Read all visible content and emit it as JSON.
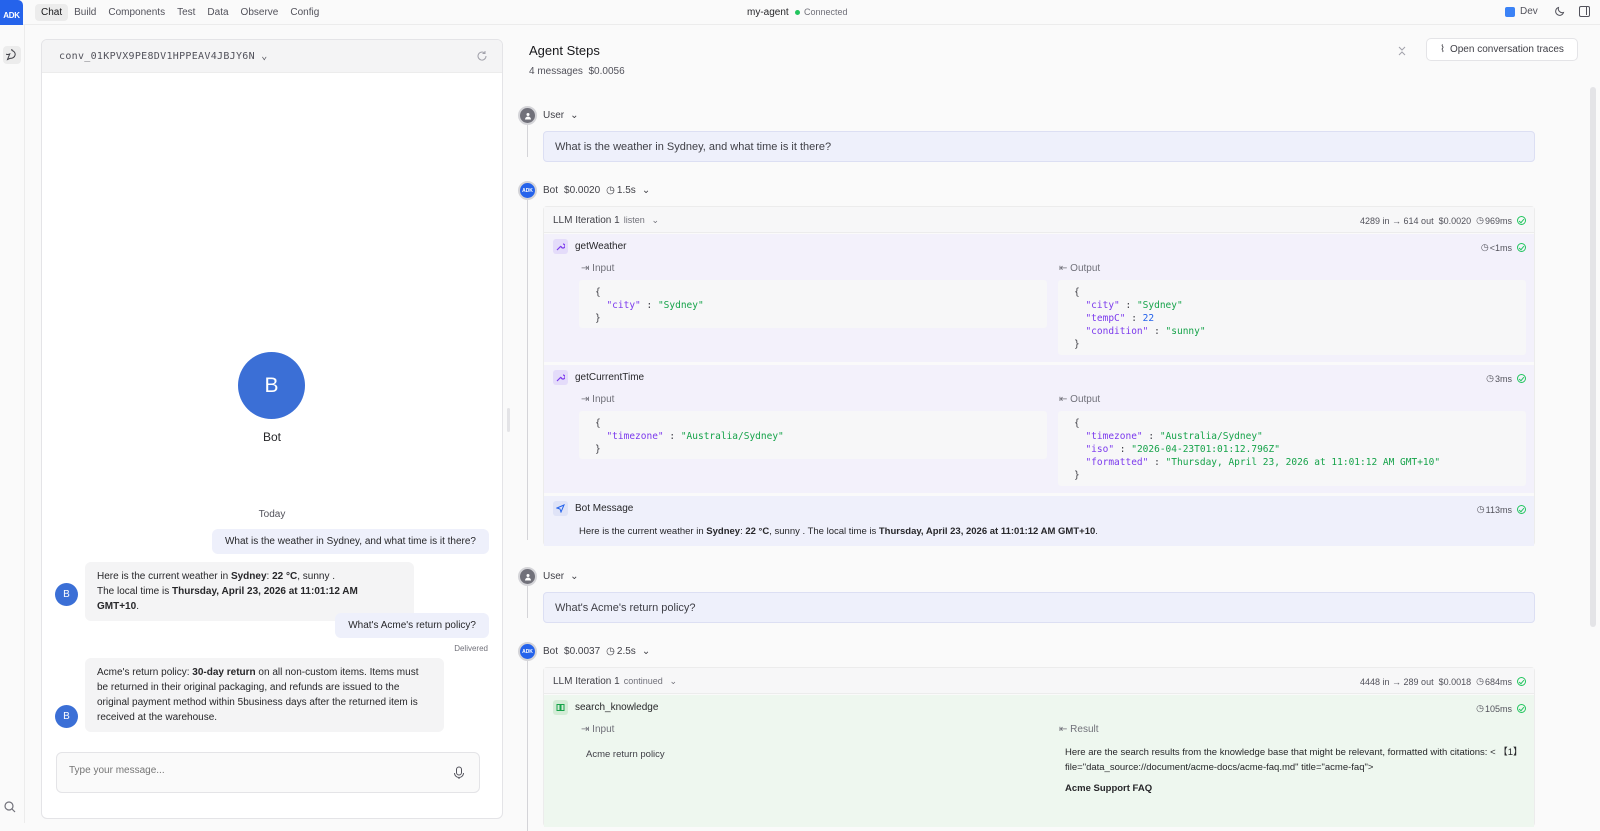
{
  "app": {
    "logo": "ADK",
    "agent_name": "my-agent",
    "status": "Connected",
    "env": "Dev"
  },
  "nav": [
    "Chat",
    "Build",
    "Components",
    "Test",
    "Data",
    "Observe",
    "Config"
  ],
  "chat": {
    "conversation_id": "conv_01KPVX9PE8DV1HPPEAV4JBJY6N",
    "bot_avatar": "B",
    "bot_name": "Bot",
    "date_divider": "Today",
    "messages": [
      {
        "role": "user",
        "text": "What is the weather in Sydney, and what time is it there?"
      },
      {
        "role": "bot",
        "avatar": "B",
        "l1_a": "Here is the current weather in ",
        "l1_b": "Sydney",
        "l1_c": ": ",
        "l1_d": "22 °C",
        ", sunny": "",
        "l1_e": ", sunny .",
        "l2_a": "The local time is ",
        "l2_b": "Thursday, April 23, 2026 at 11:01:12 AM GMT+10",
        "l2_c": "."
      },
      {
        "role": "user",
        "text": "What's Acme's return policy?"
      },
      {
        "role": "bot",
        "avatar": "B",
        "p_a": "Acme's return policy: ",
        "p_b": "30-day return",
        "p_c": " on all non-custom items. Items must be returned in their original packaging, and refunds are issued to the original payment method within",
        "p_d": "5",
        "p_e": "business days after the returned item is received at the warehouse."
      }
    ],
    "delivered": "Delivered",
    "input_placeholder": "Type your message..."
  },
  "steps": {
    "title": "Agent Steps",
    "messages_count": "4 messages",
    "cost": "$0.0056",
    "traces_button": "Open conversation traces",
    "user_label": "User",
    "bot_label": "Bot",
    "user1": "What is the weather in Sydney, and what time is it there?",
    "bot1": {
      "cost": "$0.0020",
      "time": "1.5s"
    },
    "iter1": {
      "label": "LLM Iteration 1",
      "sub": "listen",
      "stats": "4289 in → 614 out",
      "cost": "$0.0020",
      "time": "969ms"
    },
    "tool1": {
      "name": "getWeather",
      "time": "<1ms",
      "input_label": "Input",
      "output_label": "Output",
      "in_key": "\"city\"",
      "in_val": "\"Sydney\"",
      "out_k1": "\"city\"",
      "out_v1": "\"Sydney\"",
      "out_k2": "\"tempC\"",
      "out_v2": "22",
      "out_k3": "\"condition\"",
      "out_v3": "\"sunny\""
    },
    "tool2": {
      "name": "getCurrentTime",
      "time": "3ms",
      "input_label": "Input",
      "output_label": "Output",
      "in_key": "\"timezone\"",
      "in_val": "\"Australia/Sydney\"",
      "out_k1": "\"timezone\"",
      "out_v1": "\"Australia/Sydney\"",
      "out_k2": "\"iso\"",
      "out_v2": "\"2026-04-23T01:01:12.796Z\"",
      "out_k3": "\"formatted\"",
      "out_v3": "\"Thursday, April 23, 2026 at 11:01:12 AM GMT+10\""
    },
    "botmsg": {
      "label": "Bot Message",
      "time": "113ms",
      "a": "Here is the current weather in ",
      "b": "Sydney",
      "c": ": ",
      "d": "22 °C",
      "e": ", sunny . The local time is ",
      "f": "Thursday, April 23, 2026 at 11:01:12 AM GMT+10",
      "g": "."
    },
    "user2": "What's Acme's return policy?",
    "bot2": {
      "cost": "$0.0037",
      "time": "2.5s"
    },
    "iter2": {
      "label": "LLM Iteration 1",
      "sub": "continued",
      "stats": "4448 in → 289 out",
      "cost": "$0.0018",
      "time": "684ms"
    },
    "tool3": {
      "name": "search_knowledge",
      "time": "105ms",
      "input_label": "Input",
      "result_label": "Result",
      "input_val": "Acme return policy",
      "result_l1": "Here are the search results from the knowledge base that might be relevant, formatted with citations: < 【1】",
      "result_l2": "file=\"data_source://document/acme-docs/acme-faq.md\" title=\"acme-faq\">",
      "result_l3": "Acme Support FAQ"
    }
  },
  "colors": {
    "accent": "#2563eb",
    "avatar": "#3b6fd6",
    "success": "#22c55e",
    "user_bubble": "#eef0fb",
    "tool_bg": "#f3f1fb",
    "kb_bg": "#eef7ef"
  }
}
